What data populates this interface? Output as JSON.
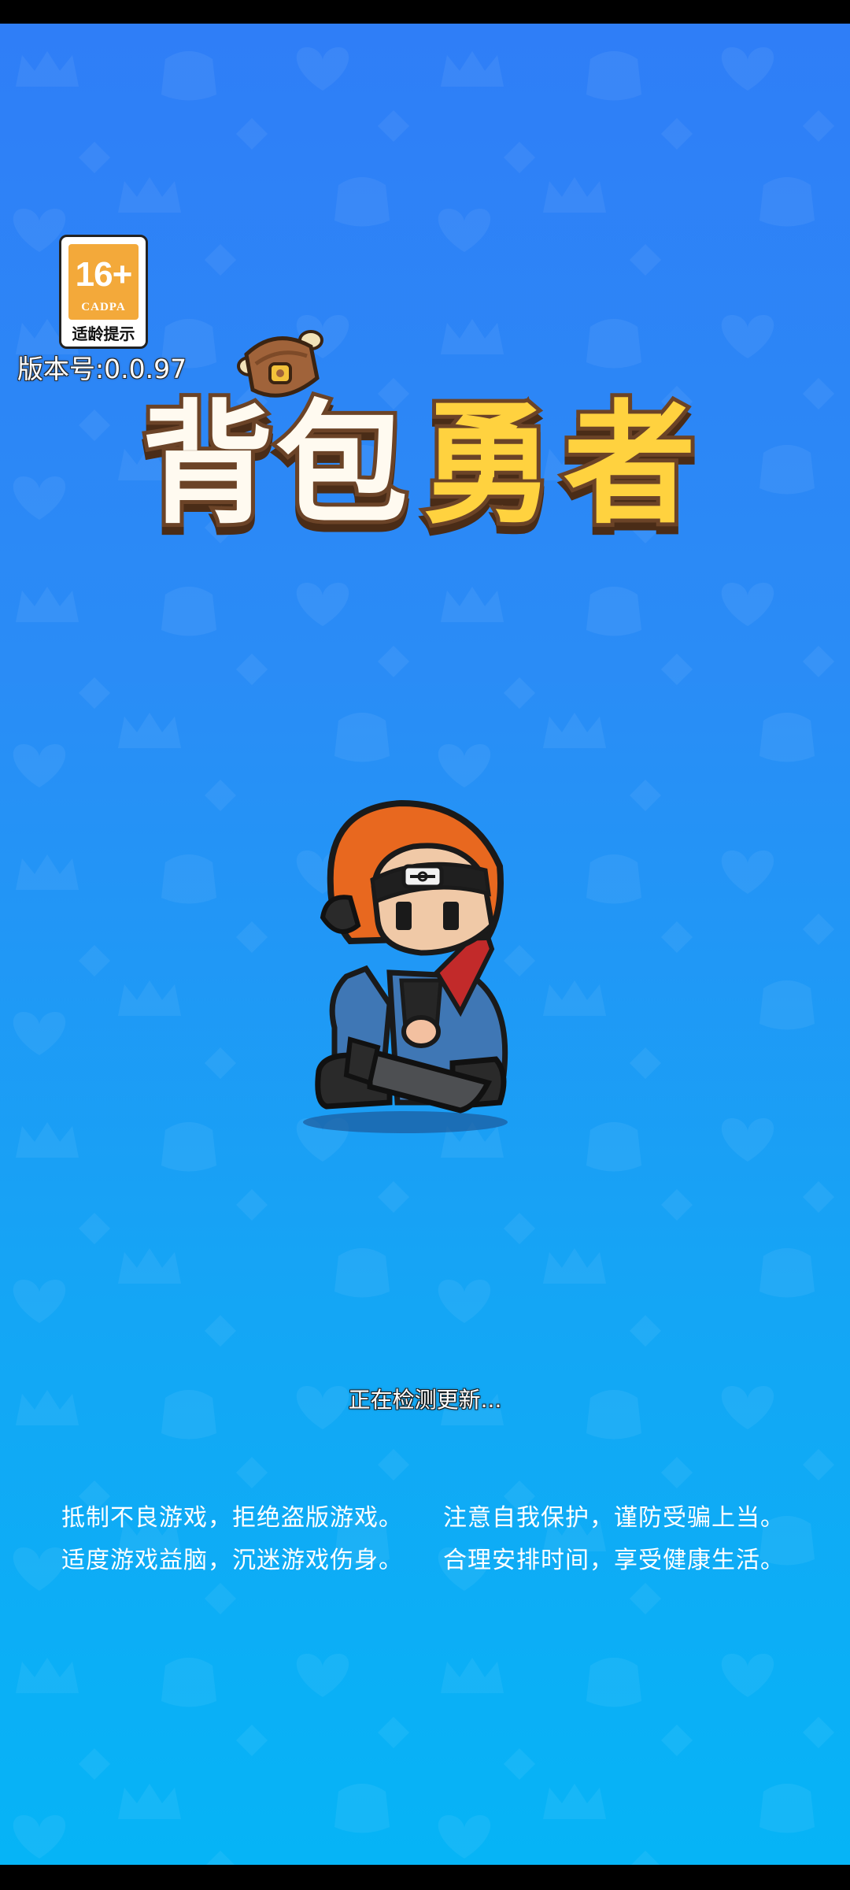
{
  "age_rating": {
    "age": "16+",
    "org": "CADPA",
    "tip": "适龄提示"
  },
  "version": "版本号:0.0.97",
  "logo": {
    "chars": [
      "背",
      "包",
      "勇",
      "者"
    ]
  },
  "status": "正在检测更新...",
  "health_notice": {
    "left": [
      "抵制不良游戏，拒绝盗版游戏。",
      "适度游戏益脑，沉迷游戏伤身。"
    ],
    "right": [
      "注意自我保护，谨防受骗上当。",
      "合理安排时间，享受健康生活。"
    ]
  },
  "colors": {
    "background_top": "#2f7ef7",
    "background_bottom": "#06b4f6",
    "logo_white": "#fffaf0",
    "logo_yellow": "#ffd23f",
    "logo_outline": "#6b4327",
    "badge_orange": "#f3a93a"
  },
  "icons": {
    "bag": "backpack-icon",
    "hero": "ninja-hero-character"
  }
}
